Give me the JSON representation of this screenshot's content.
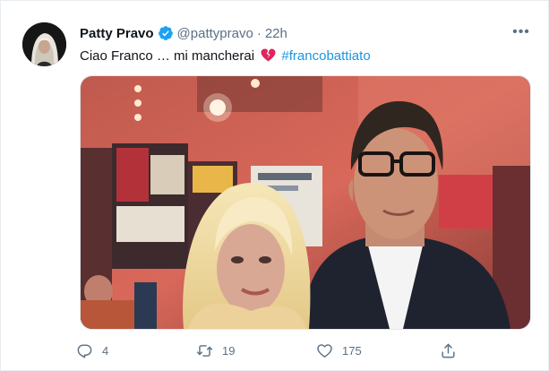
{
  "tweet": {
    "author_name": "Patty Pravo",
    "handle": "@pattypravo",
    "separator": "·",
    "time": "22h",
    "text_main": "Ciao Franco … mi mancherai",
    "hashtag": "#francobattiato",
    "more_label": "•••"
  },
  "actions": {
    "replies": "4",
    "retweets": "19",
    "likes": "175"
  },
  "icons": {
    "verified": "verified-badge-icon",
    "heart_emoji": "broken-heart-icon",
    "reply": "reply-icon",
    "retweet": "retweet-icon",
    "like": "like-icon",
    "share": "share-icon"
  },
  "colors": {
    "accent": "#1b95e0",
    "secondary_text": "#5b7083",
    "verified": "#1da1f2",
    "broken_heart": "#e0245e"
  }
}
